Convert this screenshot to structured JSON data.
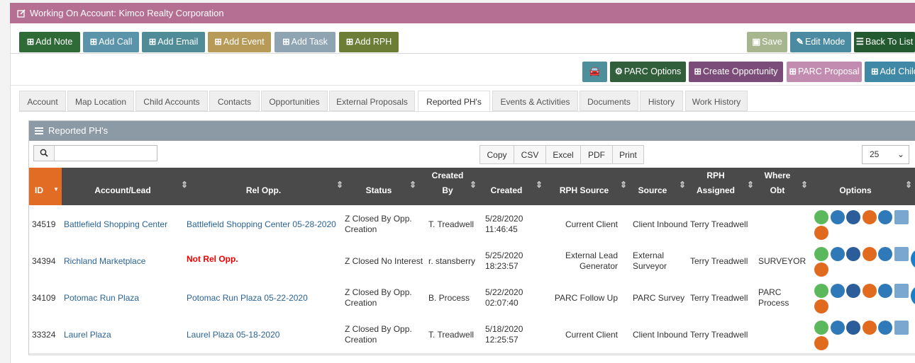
{
  "header": {
    "title": "Working On Account: Kimco Realty Corporation"
  },
  "toolbar": {
    "add_note": "Add Note",
    "add_call": "Add Call",
    "add_email": "Add Email",
    "add_event": "Add Event",
    "add_task": "Add Task",
    "add_rph": "Add RPH",
    "save": "Save",
    "edit_mode": "Edit Mode",
    "back_to_list": "Back To List"
  },
  "toolbar2": {
    "parc_options": "PARC Options",
    "create_opportunity": "Create Opportunity",
    "parc_proposal": "PARC Proposal",
    "add_child": "Add Child"
  },
  "tabs": [
    "Account",
    "Map Location",
    "Child Accounts",
    "Contacts",
    "Opportunities",
    "External Proposals",
    "Reported PH's",
    "Events & Activities",
    "Documents",
    "History",
    "Work History"
  ],
  "panel": {
    "title": "Reported PH's",
    "search_value": "",
    "exports": [
      "Copy",
      "CSV",
      "Excel",
      "PDF",
      "Print"
    ],
    "page_length": "25"
  },
  "table": {
    "headers": {
      "id": "ID",
      "account": "Account/Lead",
      "rel_opp": "Rel Opp.",
      "status": "Status",
      "created_by_1": "Created",
      "created_by_2": "By",
      "created": "Created",
      "rph_source": "RPH Source",
      "source": "Source",
      "rph_assigned_1": "RPH",
      "rph_assigned_2": "Assigned",
      "where_obt_1": "Where",
      "where_obt_2": "Obt",
      "options": "Options"
    },
    "rows": [
      {
        "id": "34519",
        "account": "Battlefield Shopping Center",
        "rel_opp": "Battlefield Shopping Center 05-28-2020",
        "rel_opp_missing": false,
        "status_1": "Z Closed By Opp.",
        "status_2": "Creation",
        "created_by": "T. Treadwell",
        "created_1": "5/28/2020",
        "created_2": "11:46:45",
        "rph_source_1": "Current Client",
        "rph_source_2": "",
        "source_1": "Client Inbound",
        "source_2": "",
        "rph_assigned": "Terry Treadwell",
        "where_obt_1": "",
        "where_obt_2": ""
      },
      {
        "id": "34394",
        "account": "Richland Marketplace",
        "rel_opp": "Not Rel Opp.",
        "rel_opp_missing": true,
        "status_1": "Z Closed No Interest",
        "status_2": "",
        "created_by": "r. stansberry",
        "created_1": "5/25/2020",
        "created_2": "18:23:57",
        "rph_source_1": "External Lead",
        "rph_source_2": "Generator",
        "source_1": "External",
        "source_2": "Surveyor",
        "rph_assigned": "Terry Treadwell",
        "where_obt_1": "SURVEYOR",
        "where_obt_2": ""
      },
      {
        "id": "34109",
        "account": "Potomac Run Plaza",
        "rel_opp": "Potomac Run Plaza 05-22-2020",
        "rel_opp_missing": false,
        "status_1": "Z Closed By Opp.",
        "status_2": "Creation",
        "created_by": "B. Process",
        "created_1": "5/22/2020",
        "created_2": "02:07:40",
        "rph_source_1": "PARC Follow Up",
        "rph_source_2": "",
        "source_1": "PARC Survey",
        "source_2": "",
        "rph_assigned": "Terry Treadwell",
        "where_obt_1": "PARC",
        "where_obt_2": "Process"
      },
      {
        "id": "33324",
        "account": "Laurel Plaza",
        "rel_opp": "Laurel Plaza 05-18-2020",
        "rel_opp_missing": false,
        "status_1": "Z Closed By Opp.",
        "status_2": "Creation",
        "created_by": "T. Treadwell",
        "created_1": "5/18/2020",
        "created_2": "12:25:57",
        "rph_source_1": "Current Client",
        "rph_source_2": "",
        "source_1": "Client Inbound",
        "source_2": "",
        "rph_assigned": "Terry Treadwell",
        "where_obt_1": "",
        "where_obt_2": ""
      }
    ]
  },
  "colors": {
    "header_bg": "#b56f92",
    "add_note": "#2f6b37",
    "add_call": "#5b93ab",
    "add_email": "#4f8c97",
    "add_event": "#b89a58",
    "add_task": "#8fa4b3",
    "add_rph": "#6c7d36",
    "save": "#a8b690",
    "edit_mode": "#4b8ba2",
    "back_to_list": "#235a30",
    "parc_options": "#315f3c",
    "create_opportunity": "#7b4c79",
    "parc_proposal": "#c28cb0",
    "add_child": "#3f89a6",
    "sort_id": "#e36c25"
  },
  "option_icons": [
    "view-green-icon",
    "email-icon",
    "music-icon",
    "clock-icon",
    "eye-icon",
    "add-image-icon",
    "tag-icon"
  ]
}
